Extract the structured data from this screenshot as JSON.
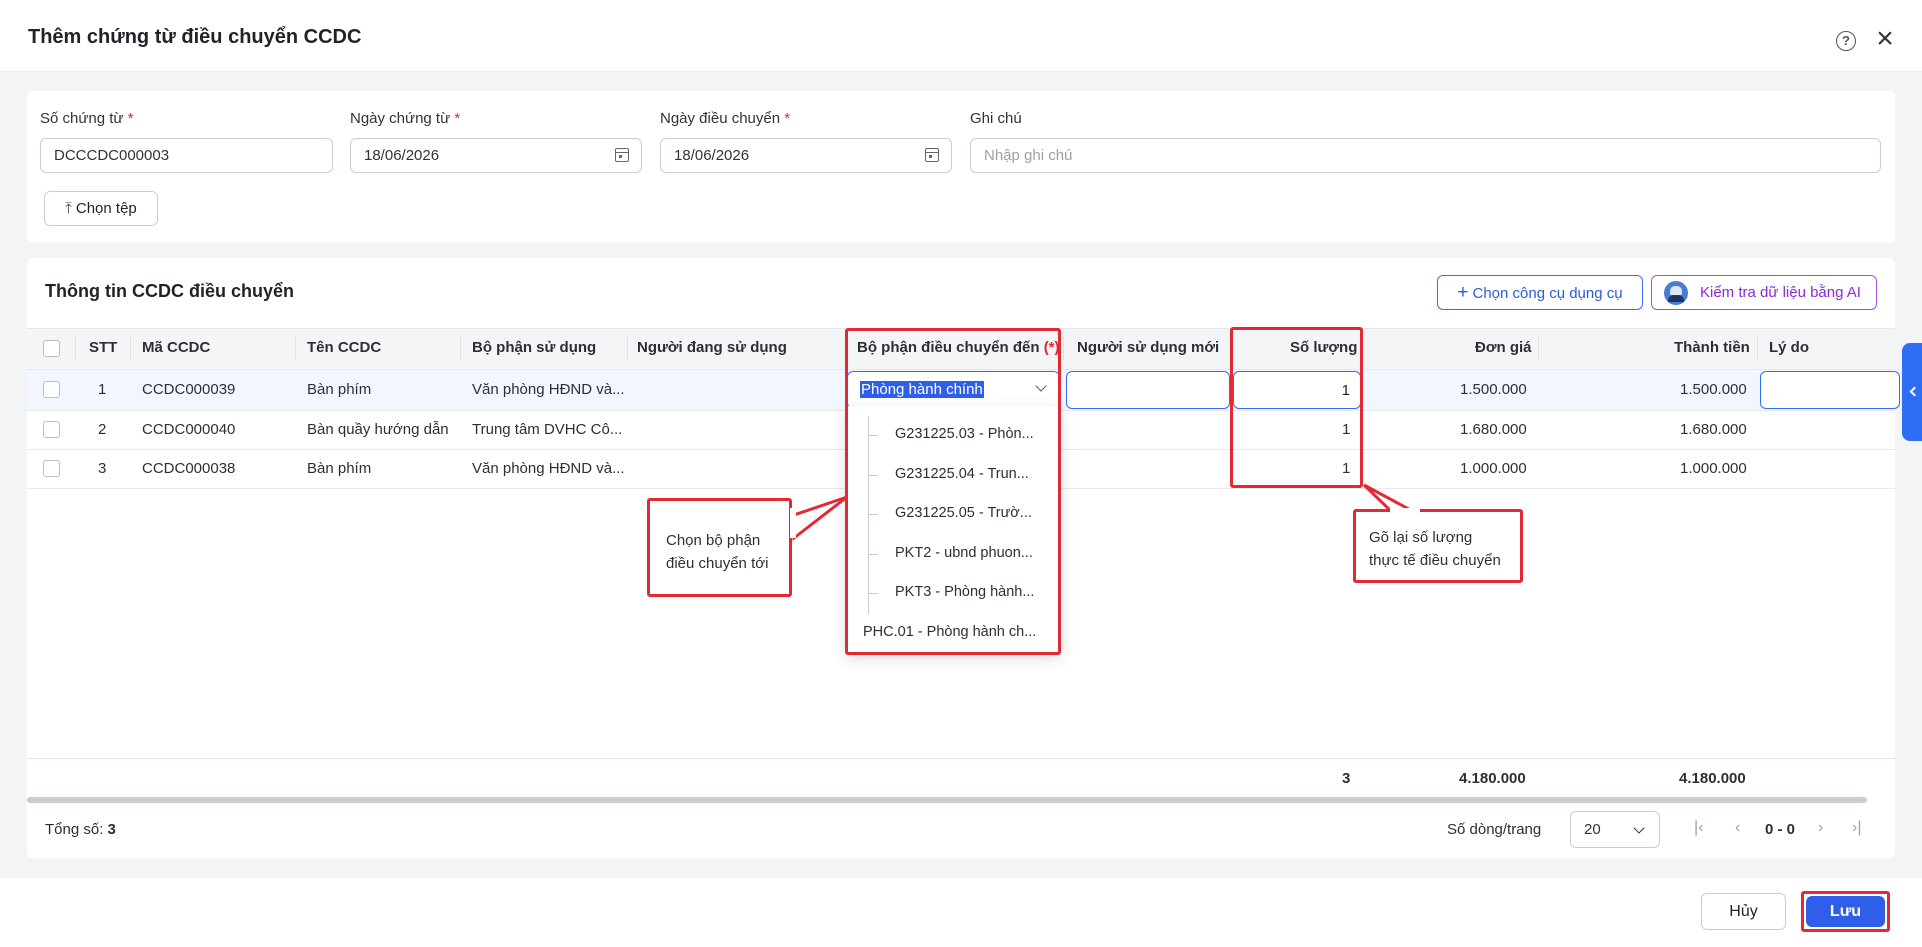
{
  "dialog": {
    "title": "Thêm chứng từ điều chuyển CCDC",
    "help_icon": "?",
    "close_icon": "×"
  },
  "form": {
    "doc_no_label": "Số chứng từ",
    "doc_no_value": "DCCCDC000003",
    "doc_date_label": "Ngày chứng từ",
    "doc_date_value": "18/06/2026",
    "transfer_date_label": "Ngày điều chuyển",
    "transfer_date_value": "18/06/2026",
    "note_label": "Ghi chú",
    "note_placeholder": "Nhập ghi chú",
    "required_mark": "*",
    "upload_label": "Chọn tệp"
  },
  "section": {
    "title": "Thông tin CCDC điều chuyển",
    "choose_tool_label": "Chọn công cụ dụng cụ",
    "ai_check_label": "Kiểm tra dữ liệu bằng AI"
  },
  "table": {
    "headers": {
      "stt": "STT",
      "code": "Mã CCDC",
      "name": "Tên CCDC",
      "dept": "Bộ phận sử dụng",
      "user": "Người đang sử dụng",
      "to_dept": "Bộ phận điều chuyển đến",
      "to_dept_req": "(*)",
      "new_user": "Người sử dụng mới",
      "qty": "Số lượng",
      "price": "Đơn giá",
      "amount": "Thành tiền",
      "reason": "Lý do"
    },
    "rows": [
      {
        "stt": "1",
        "code": "CCDC000039",
        "name": "Bàn phím",
        "dept": "Văn phòng HĐND và...",
        "to_dept": "Phòng hành chính",
        "qty": "1",
        "price": "1.500.000",
        "amount": "1.500.000"
      },
      {
        "stt": "2",
        "code": "CCDC000040",
        "name": "Bàn quầy hướng dẫn",
        "dept": "Trung tâm DVHC Cô...",
        "qty": "1",
        "price": "1.680.000",
        "amount": "1.680.000"
      },
      {
        "stt": "3",
        "code": "CCDC000038",
        "name": "Bàn phím",
        "dept": "Văn phòng HĐND và...",
        "qty": "1",
        "price": "1.000.000",
        "amount": "1.000.000"
      }
    ],
    "totals": {
      "qty": "3",
      "price": "4.180.000",
      "amount": "4.180.000"
    }
  },
  "dropdown": {
    "items": [
      "G231225.03 - Phòn...",
      "G231225.04 - Trun...",
      "G231225.05 - Trườ...",
      "PKT2 - ubnd phuon...",
      "PKT3 - Phòng hành...",
      "PHC.01 - Phòng hành ch..."
    ]
  },
  "pagination": {
    "total_label": "Tổng số:",
    "total_value": "3",
    "rows_per_page_label": "Số dòng/trang",
    "rows_per_page_value": "20",
    "range": "0 - 0"
  },
  "annotations": {
    "callout_dept_line1": "Chọn bộ phận",
    "callout_dept_line2": "điều chuyển tới",
    "callout_qty_line1": "Gõ lại số lượng",
    "callout_qty_line2": "thực tế điều chuyển"
  },
  "footer": {
    "cancel_label": "Hủy",
    "save_label": "Lưu"
  },
  "colors": {
    "primary": "#2f5fe8",
    "highlight": "#e02b35",
    "ai": "#8a2ad6"
  }
}
